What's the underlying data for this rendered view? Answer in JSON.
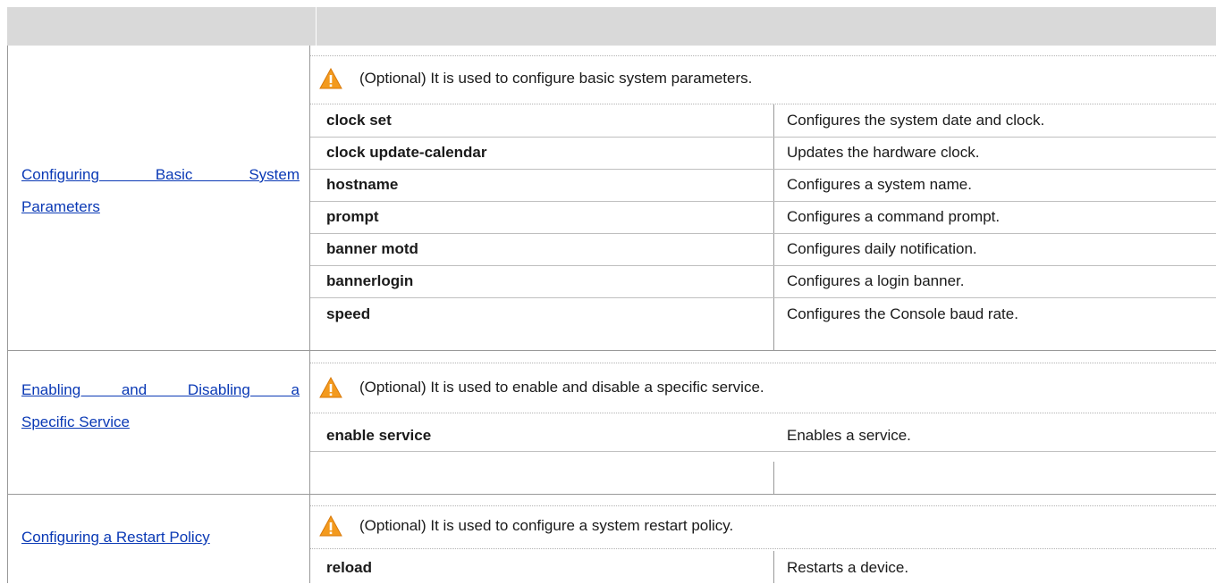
{
  "table": {
    "header": {
      "col1": "",
      "col2": ""
    },
    "sections": [
      {
        "link_line1": "Configuring   Basic   System",
        "link_line2": "Parameters",
        "note": "(Optional) It is used to configure basic system parameters.",
        "note_icon": "warning-icon",
        "commands": [
          {
            "cmd": "clock set",
            "desc": "Configures the system date and clock."
          },
          {
            "cmd": "clock update-calendar",
            "desc": "Updates the hardware clock."
          },
          {
            "cmd": "hostname",
            "desc": "Configures a system name."
          },
          {
            "cmd": "prompt",
            "desc": "Configures a command prompt."
          },
          {
            "cmd": "banner motd",
            "desc": "Configures daily notification."
          },
          {
            "cmd": "bannerlogin",
            "desc": "Configures a login banner."
          },
          {
            "cmd": "speed",
            "desc": "Configures the Console baud rate."
          }
        ]
      },
      {
        "link_line1": "Enabling   and   Disabling   a",
        "link_line2": "Specific Service",
        "note": "(Optional) It is used to enable and disable a specific service.",
        "note_icon": "warning-icon",
        "commands": [
          {
            "cmd": "enable service",
            "desc": "Enables a service."
          }
        ]
      },
      {
        "link_line1": "Configuring a Restart Policy",
        "note": "(Optional) It is used to configure a system restart policy.",
        "note_icon": "warning-icon",
        "commands": [
          {
            "cmd": "reload",
            "desc": "Restarts a device."
          }
        ]
      }
    ]
  },
  "colors": {
    "link": "#0a39b5",
    "header_bg": "#d9d9d9",
    "warning": "#f39a1e"
  }
}
